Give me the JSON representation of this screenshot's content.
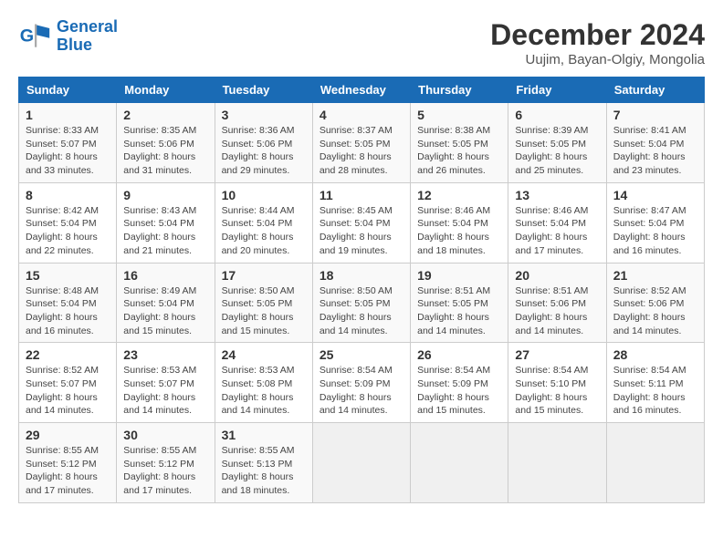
{
  "logo": {
    "line1": "General",
    "line2": "Blue"
  },
  "title": "December 2024",
  "subtitle": "Uujim, Bayan-Olgiy, Mongolia",
  "days_header": [
    "Sunday",
    "Monday",
    "Tuesday",
    "Wednesday",
    "Thursday",
    "Friday",
    "Saturday"
  ],
  "weeks": [
    [
      {
        "day": "1",
        "info": "Sunrise: 8:33 AM\nSunset: 5:07 PM\nDaylight: 8 hours and 33 minutes."
      },
      {
        "day": "2",
        "info": "Sunrise: 8:35 AM\nSunset: 5:06 PM\nDaylight: 8 hours and 31 minutes."
      },
      {
        "day": "3",
        "info": "Sunrise: 8:36 AM\nSunset: 5:06 PM\nDaylight: 8 hours and 29 minutes."
      },
      {
        "day": "4",
        "info": "Sunrise: 8:37 AM\nSunset: 5:05 PM\nDaylight: 8 hours and 28 minutes."
      },
      {
        "day": "5",
        "info": "Sunrise: 8:38 AM\nSunset: 5:05 PM\nDaylight: 8 hours and 26 minutes."
      },
      {
        "day": "6",
        "info": "Sunrise: 8:39 AM\nSunset: 5:05 PM\nDaylight: 8 hours and 25 minutes."
      },
      {
        "day": "7",
        "info": "Sunrise: 8:41 AM\nSunset: 5:04 PM\nDaylight: 8 hours and 23 minutes."
      }
    ],
    [
      {
        "day": "8",
        "info": "Sunrise: 8:42 AM\nSunset: 5:04 PM\nDaylight: 8 hours and 22 minutes."
      },
      {
        "day": "9",
        "info": "Sunrise: 8:43 AM\nSunset: 5:04 PM\nDaylight: 8 hours and 21 minutes."
      },
      {
        "day": "10",
        "info": "Sunrise: 8:44 AM\nSunset: 5:04 PM\nDaylight: 8 hours and 20 minutes."
      },
      {
        "day": "11",
        "info": "Sunrise: 8:45 AM\nSunset: 5:04 PM\nDaylight: 8 hours and 19 minutes."
      },
      {
        "day": "12",
        "info": "Sunrise: 8:46 AM\nSunset: 5:04 PM\nDaylight: 8 hours and 18 minutes."
      },
      {
        "day": "13",
        "info": "Sunrise: 8:46 AM\nSunset: 5:04 PM\nDaylight: 8 hours and 17 minutes."
      },
      {
        "day": "14",
        "info": "Sunrise: 8:47 AM\nSunset: 5:04 PM\nDaylight: 8 hours and 16 minutes."
      }
    ],
    [
      {
        "day": "15",
        "info": "Sunrise: 8:48 AM\nSunset: 5:04 PM\nDaylight: 8 hours and 16 minutes."
      },
      {
        "day": "16",
        "info": "Sunrise: 8:49 AM\nSunset: 5:04 PM\nDaylight: 8 hours and 15 minutes."
      },
      {
        "day": "17",
        "info": "Sunrise: 8:50 AM\nSunset: 5:05 PM\nDaylight: 8 hours and 15 minutes."
      },
      {
        "day": "18",
        "info": "Sunrise: 8:50 AM\nSunset: 5:05 PM\nDaylight: 8 hours and 14 minutes."
      },
      {
        "day": "19",
        "info": "Sunrise: 8:51 AM\nSunset: 5:05 PM\nDaylight: 8 hours and 14 minutes."
      },
      {
        "day": "20",
        "info": "Sunrise: 8:51 AM\nSunset: 5:06 PM\nDaylight: 8 hours and 14 minutes."
      },
      {
        "day": "21",
        "info": "Sunrise: 8:52 AM\nSunset: 5:06 PM\nDaylight: 8 hours and 14 minutes."
      }
    ],
    [
      {
        "day": "22",
        "info": "Sunrise: 8:52 AM\nSunset: 5:07 PM\nDaylight: 8 hours and 14 minutes."
      },
      {
        "day": "23",
        "info": "Sunrise: 8:53 AM\nSunset: 5:07 PM\nDaylight: 8 hours and 14 minutes."
      },
      {
        "day": "24",
        "info": "Sunrise: 8:53 AM\nSunset: 5:08 PM\nDaylight: 8 hours and 14 minutes."
      },
      {
        "day": "25",
        "info": "Sunrise: 8:54 AM\nSunset: 5:09 PM\nDaylight: 8 hours and 14 minutes."
      },
      {
        "day": "26",
        "info": "Sunrise: 8:54 AM\nSunset: 5:09 PM\nDaylight: 8 hours and 15 minutes."
      },
      {
        "day": "27",
        "info": "Sunrise: 8:54 AM\nSunset: 5:10 PM\nDaylight: 8 hours and 15 minutes."
      },
      {
        "day": "28",
        "info": "Sunrise: 8:54 AM\nSunset: 5:11 PM\nDaylight: 8 hours and 16 minutes."
      }
    ],
    [
      {
        "day": "29",
        "info": "Sunrise: 8:55 AM\nSunset: 5:12 PM\nDaylight: 8 hours and 17 minutes."
      },
      {
        "day": "30",
        "info": "Sunrise: 8:55 AM\nSunset: 5:12 PM\nDaylight: 8 hours and 17 minutes."
      },
      {
        "day": "31",
        "info": "Sunrise: 8:55 AM\nSunset: 5:13 PM\nDaylight: 8 hours and 18 minutes."
      },
      null,
      null,
      null,
      null
    ]
  ]
}
